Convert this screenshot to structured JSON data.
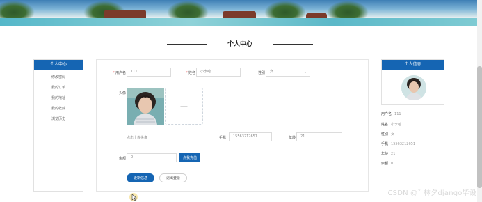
{
  "page_title": "个人中心",
  "sidebar": {
    "header": "个人中心",
    "items": [
      {
        "label": "修改密码"
      },
      {
        "label": "我的订单"
      },
      {
        "label": "我的地址"
      },
      {
        "label": "我的收藏"
      },
      {
        "label": "浏览历史"
      }
    ]
  },
  "form": {
    "username_label": "用户名",
    "username_value": "111",
    "name_label": "姓名",
    "name_value": "小李哈",
    "gender_label": "性别",
    "gender_value": "女",
    "avatar_label": "头像",
    "upload_hint": "点击上传头像",
    "phone_label": "手机",
    "phone_value": "15563212651",
    "age_label": "年龄",
    "age_value": "21",
    "balance_label": "余额",
    "balance_value": "0",
    "recharge_button": "点我充值",
    "update_button": "更新信息",
    "logout_button": "退出登录",
    "required_mark": "*",
    "plus_glyph": "+"
  },
  "profile": {
    "header": "个人信息",
    "fields": [
      {
        "label": "用户名",
        "value": "111"
      },
      {
        "label": "姓名",
        "value": "小李哈"
      },
      {
        "label": "性别",
        "value": "女"
      },
      {
        "label": "手机",
        "value": "15563212651"
      },
      {
        "label": "年龄",
        "value": "21"
      },
      {
        "label": "余额",
        "value": "0"
      }
    ]
  },
  "watermark": "CSDN @ˇ 林夕django毕设",
  "colors": {
    "accent": "#1565b3"
  },
  "icons": {
    "plus": "plus-icon",
    "caret": "chevron-down-icon",
    "cursor": "cursor-icon"
  }
}
